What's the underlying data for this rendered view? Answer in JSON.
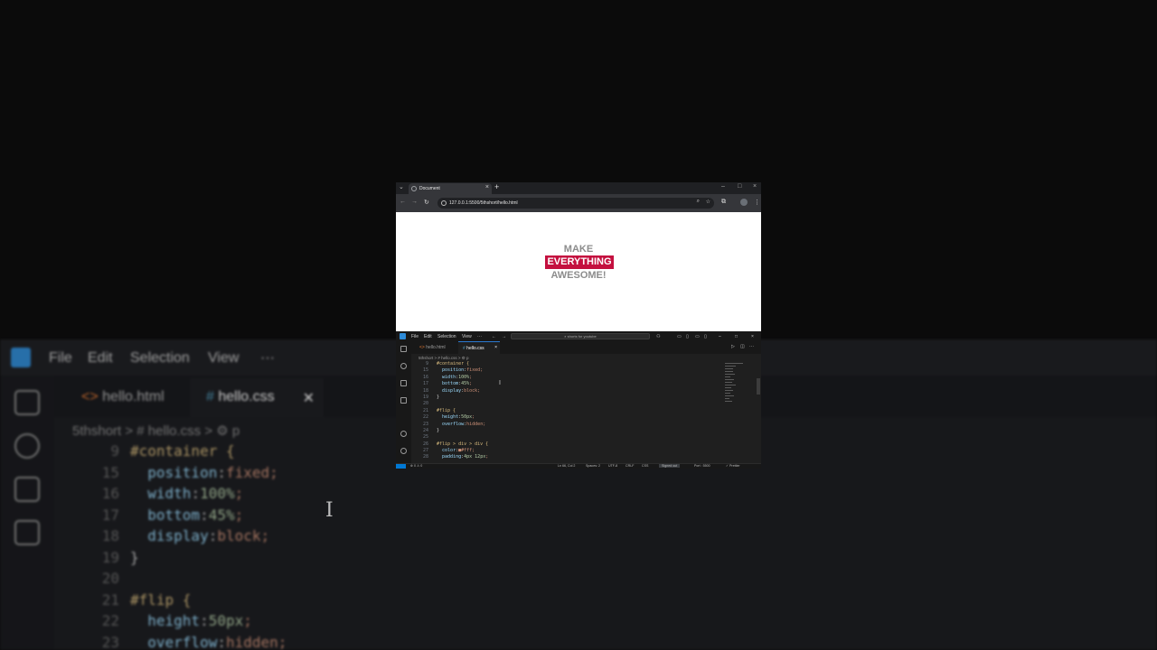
{
  "bg_editor": {
    "menu": [
      "File",
      "Edit",
      "Selection",
      "View",
      "···"
    ],
    "tabs": [
      {
        "label": "hello.html",
        "icon": "html-icon"
      },
      {
        "label": "hello.css",
        "icon": "css-icon"
      }
    ],
    "breadcrumb": "5thshort  >  #  hello.css  >  ⚙ p",
    "code": [
      {
        "n": "9",
        "t": "#container {"
      },
      {
        "n": "15",
        "t": "  position:fixed;"
      },
      {
        "n": "16",
        "t": "  width:100%;"
      },
      {
        "n": "17",
        "t": "  bottom:45%;"
      },
      {
        "n": "18",
        "t": "  display:block;"
      },
      {
        "n": "19",
        "t": "}"
      },
      {
        "n": "20",
        "t": ""
      },
      {
        "n": "21",
        "t": "#flip {"
      },
      {
        "n": "22",
        "t": "  height:50px;"
      },
      {
        "n": "23",
        "t": "  overflow:hidden;"
      }
    ]
  },
  "browser": {
    "tab_title": "Document",
    "new_tab": "+",
    "address": "127.0.0.1:5500/5thshort/hello.html",
    "page": {
      "line1": "MAKE",
      "line2": "EVERYTHING",
      "line3": "AWESOME!"
    },
    "accent_color": "#c4103f"
  },
  "vscode": {
    "menu": [
      "File",
      "Edit",
      "Selection",
      "View",
      "···"
    ],
    "search_placeholder": "shorts for youtube",
    "tabs": [
      {
        "label": "hello.html",
        "active": false
      },
      {
        "label": "hello.css",
        "active": true
      }
    ],
    "breadcrumb": "5thshort > # hello.css > ⚙ p",
    "code": [
      {
        "n": "9",
        "t": "#container {"
      },
      {
        "n": "15",
        "t": "  position:fixed;"
      },
      {
        "n": "16",
        "t": "  width:100%;"
      },
      {
        "n": "17",
        "t": "  bottom:45%;"
      },
      {
        "n": "18",
        "t": "  display:block;"
      },
      {
        "n": "19",
        "t": "}"
      },
      {
        "n": "20",
        "t": ""
      },
      {
        "n": "21",
        "t": "#flip {"
      },
      {
        "n": "22",
        "t": "  height:50px;"
      },
      {
        "n": "23",
        "t": "  overflow:hidden;"
      },
      {
        "n": "24",
        "t": "}"
      },
      {
        "n": "25",
        "t": ""
      },
      {
        "n": "26",
        "t": "#flip > div > div {"
      },
      {
        "n": "27",
        "t": "  color:■#fff;"
      },
      {
        "n": "28",
        "t": "  padding:4px 12px;"
      }
    ],
    "status": {
      "problems": "⊗ 0 ⚠ 0",
      "position": "Ln 66, Col 2",
      "spaces": "Spaces: 2",
      "encoding": "UTF-8",
      "eol": "CRLF",
      "language": "CSS",
      "account": "Signed out",
      "port": "Port : 5500",
      "formatter": "✓ Prettier"
    }
  }
}
